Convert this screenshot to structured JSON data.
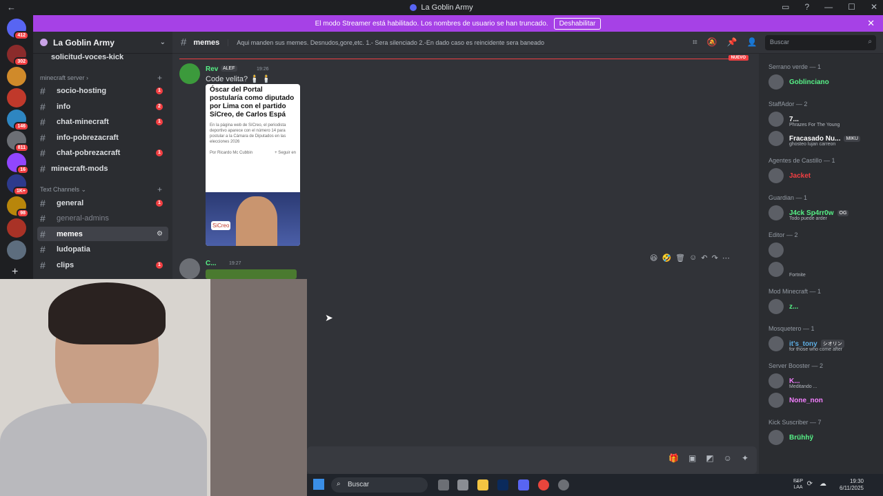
{
  "window": {
    "title": "La Goblin Army",
    "back": "←",
    "controls": [
      "▭",
      "?",
      "—",
      "☐",
      "✕"
    ]
  },
  "banner": {
    "text": "El modo Streamer está habilitado. Los nombres de usuario se han truncado.",
    "button": "Deshabilitar",
    "close": "✕"
  },
  "rail": {
    "home_badge": "412",
    "servers": [
      {
        "badge": "302",
        "color": "#8b2b2b"
      },
      {
        "badge": "",
        "color": "#d08a2a"
      },
      {
        "badge": "",
        "color": "#c0392b"
      },
      {
        "badge": "146",
        "color": "#2e86c1"
      },
      {
        "badge": "811",
        "color": "#6c6f75"
      },
      {
        "badge": "16",
        "color": "#9146ff"
      },
      {
        "badge": "1K+",
        "color": "#2d3a8c"
      },
      {
        "badge": "98",
        "color": "#b8860b"
      },
      {
        "badge": "",
        "color": "#a93226"
      },
      {
        "badge": "",
        "color": "#5d6d7e"
      }
    ],
    "add": "+"
  },
  "guild": {
    "name": "La Goblin Army",
    "chevron": "⌄"
  },
  "channels": {
    "top_channel": "solicitud-voces-kick",
    "category1": "minecraft server",
    "cat1_channels": [
      {
        "name": "socio-hosting",
        "badge": "1"
      },
      {
        "name": "info",
        "badge": "2"
      },
      {
        "name": "chat-minecraft",
        "badge": "1"
      },
      {
        "name": "info-pobrezacraft",
        "badge": ""
      },
      {
        "name": "chat-pobrezacraft",
        "badge": "1"
      },
      {
        "name": "minecraft-mods",
        "badge": ""
      }
    ],
    "category2": "Text Channels",
    "cat2_channels": [
      {
        "name": "general",
        "badge": "1"
      },
      {
        "name": "general-admins",
        "badge": ""
      },
      {
        "name": "memes",
        "badge": ""
      },
      {
        "name": "ludopatia",
        "badge": ""
      },
      {
        "name": "clips",
        "badge": "1"
      }
    ]
  },
  "header": {
    "channel": "memes",
    "topic": "Aqui manden sus memes. Desnudos,gore,etc. 1.- Sera silenciado 2.-En dado caso es reincidente sera baneado",
    "search_placeholder": "Buscar"
  },
  "messages": {
    "new_marker": "NUEVO",
    "msg1": {
      "author": "Rev",
      "tag": "ALEF",
      "time": "19:26",
      "text": "Code velita? 🕯️ 🕯️",
      "embed_title": "Óscar del Portal postularía como diputado por Lima con el partido SíCreo, de Carlos Espá",
      "embed_body": "En la página web de SíCreo, el periodista deportivo aparece con el número 14 para postular a la Cámara de Diputados en las elecciones 2026",
      "embed_author": "Por Ricardo Mc Cubbin",
      "embed_follow": "+ Seguir en",
      "embed_logo": "SiCreo"
    },
    "msg2": {
      "author": "C...",
      "time": "19:27"
    }
  },
  "members": [
    {
      "group": "Serrano verde — 1",
      "items": [
        {
          "name": "Goblinciano",
          "color": "#57f287",
          "sub": ""
        }
      ]
    },
    {
      "group": "StaffAdor — 2",
      "items": [
        {
          "name": "7...",
          "color": "#ffffff",
          "sub": "Phrazes For The Young"
        },
        {
          "name": "Fracasado Nu...",
          "color": "#ffffff",
          "sub": "ghosteo lujan carreon",
          "tag": "MIKU"
        }
      ]
    },
    {
      "group": "Agentes de Castillo — 1",
      "items": [
        {
          "name": "Jacket",
          "color": "#f23f42",
          "sub": ""
        }
      ]
    },
    {
      "group": "Guardian — 1",
      "items": [
        {
          "name": "J4ck Sp4rr0w",
          "color": "#57f287",
          "sub": "Todo puede arder",
          "tag": "OG"
        }
      ]
    },
    {
      "group": "Editor — 2",
      "items": [
        {
          "name": "",
          "color": "#ffffff",
          "sub": ""
        },
        {
          "name": "",
          "color": "#f23f42",
          "sub": "Fortnite"
        }
      ]
    },
    {
      "group": "Mod Minecraft — 1",
      "items": [
        {
          "name": "z...",
          "color": "#57f287",
          "sub": ""
        }
      ]
    },
    {
      "group": "Mosquetero — 1",
      "items": [
        {
          "name": "it's_tony",
          "color": "#5dade2",
          "sub": "for those who come after",
          "tag": "シオリン"
        }
      ]
    },
    {
      "group": "Server Booster — 2",
      "items": [
        {
          "name": "K...",
          "color": "#f47fff",
          "sub": "Meditando ..."
        },
        {
          "name": "None_non",
          "color": "#f47fff",
          "sub": ""
        }
      ]
    },
    {
      "group": "Kick Suscriber — 7",
      "items": [
        {
          "name": "Brühhÿ",
          "color": "#57f287",
          "sub": ""
        }
      ]
    }
  ],
  "taskbar": {
    "search": "Buscar",
    "lang": "ESP\nLAA",
    "time": "19:30",
    "date": "6/11/2025"
  }
}
